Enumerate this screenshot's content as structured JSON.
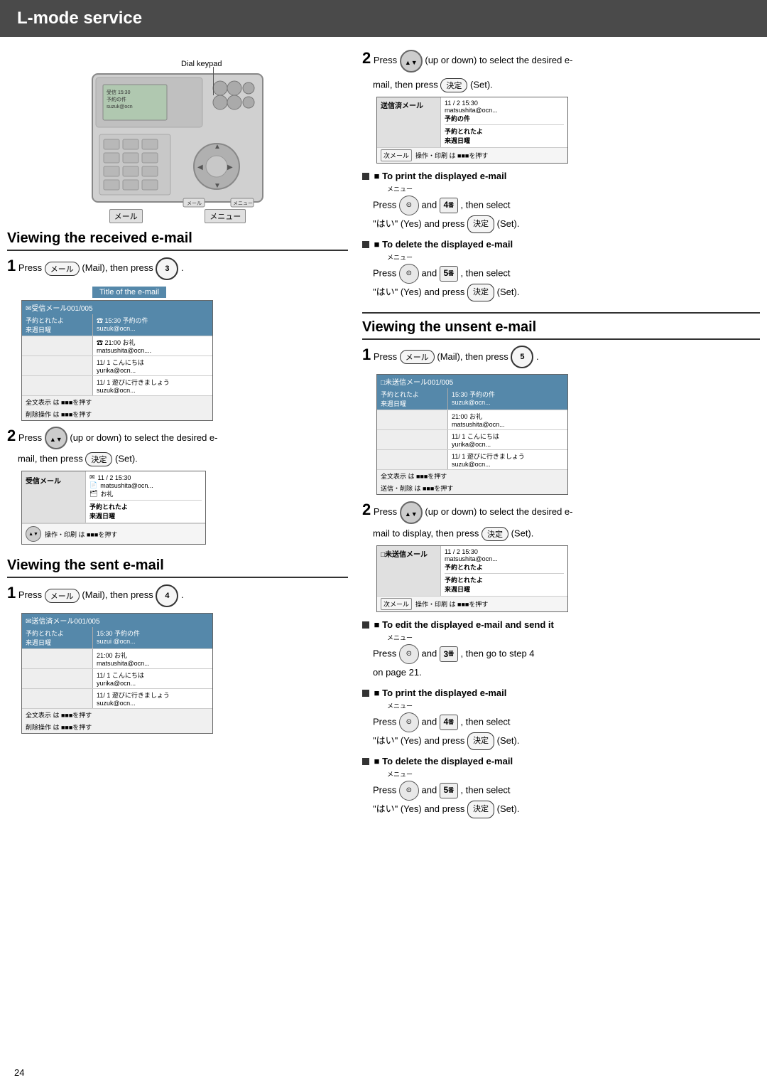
{
  "header": {
    "title": "L-mode service"
  },
  "page_number": "24",
  "device_labels": {
    "dial_keypad": "Dial keypad",
    "mail_button": "メール",
    "menu_button": "メニュー"
  },
  "section_received": {
    "title": "Viewing the received e-mail",
    "step1_text": "Press",
    "step1_mail": "メール",
    "step1_then": "(Mail), then press",
    "step1_num": "3",
    "step2_text": "Press",
    "step2_updown": "(up or down) to select the desired e-",
    "step2_mail_then": "mail, then press",
    "step2_set": "決定",
    "step2_set_label": "(Set).",
    "title_of_email": "Title of the e-mail",
    "screen1": {
      "header": "✉受信メール001/005",
      "row1_right1": "☎ 15:30 予約の件",
      "row1_right2": "suzuk@ocn...",
      "row2_left": "予約とれたよ\n来週日曜",
      "row2_right1": "☎ 21:00 お礼",
      "row2_right2": "matsushita@ocn....",
      "row3_right1": "11/ 1 こんにちは",
      "row3_right2": "yurika@ocn...",
      "footer1": "全文表示 は ■■■を押す",
      "footer2": "削除操作 は ■■■を押す",
      "row4_right1": "11/ 1 遊びに行きましょう",
      "row4_right2": "suzuk@ocn..."
    },
    "screen2": {
      "header_left": "受信メール",
      "icon1": "✉",
      "date": "11 / 2  15:30",
      "icon2": "📄",
      "sender": "matsushita@ocn...",
      "icon3": "🗂",
      "subject": "お礼",
      "divider": "──────────────",
      "body1": "予約とれたよ",
      "body2": "来週日曜",
      "footer": "操作・印刷 は ■■■を押す"
    }
  },
  "section_sent": {
    "title": "Viewing the sent e-mail",
    "step1_text": "Press",
    "step1_mail": "メール",
    "step1_then": "(Mail), then press",
    "step1_num": "4",
    "screen1": {
      "header": "✉送信済メール001/005",
      "row1_right1": "15:30 予約の件",
      "row1_right2": "suzui @ocn...",
      "row2_left": "予約とれたよ\n来週日曜",
      "row2_right1": "21:00 お礼",
      "row2_right2": "matsushita@ocn...",
      "row3_right1": "11/ 1 こんにちは",
      "row3_right2": "yurika@ocn...",
      "footer1": "全文表示 は ■■■を押す",
      "footer2": "削除操作 は ■■■を押す",
      "row4_right1": "11/ 1 遊びに行きましょう",
      "row4_right2": "suzuk@ocn..."
    }
  },
  "section_right_top": {
    "step2_text": "Press",
    "step2_updown": "(up or down) to select the desired e-",
    "step2_mail_then": "mail, then press",
    "step2_set": "決定",
    "step2_set_label": "(Set).",
    "screen": {
      "header_left": "送信済メール",
      "icon_menu": "次メール",
      "date": "11 / 2  15:30",
      "sender": "matsushita@ocn...",
      "subject": "予約の件",
      "body1": "予約とれたよ",
      "body2": "来週日曜",
      "footer": "操作・印刷 は ■■■を押す"
    },
    "print_section": {
      "title": "■ To print the displayed e-mail",
      "menu_label": "メニュー",
      "press": "Press",
      "menu_btn": "Menu",
      "and": "and",
      "num": "4",
      "then_select": ", then select",
      "hai": "\"はい\" (Yes) and press",
      "set": "決定",
      "set_label": "(Set)."
    },
    "delete_section": {
      "title": "■ To delete the displayed e-mail",
      "menu_label": "メニュー",
      "press": "Press",
      "menu_btn": "Menu",
      "and": "and",
      "num": "5",
      "then_select": ", then select",
      "hai": "\"はい\" (Yes) and press",
      "set": "決定",
      "set_label": "(Set)."
    }
  },
  "section_unsent": {
    "title": "Viewing the unsent e-mail",
    "step1_text": "Press",
    "step1_mail": "メール",
    "step1_then": "(Mail), then press",
    "step1_num": "5",
    "screen1": {
      "header": "□未送信メール001/005",
      "row1_right1": "15:30 予約の件",
      "row1_right2": "suzuk@ocn...",
      "row2_left": "予約とれたよ\n来週日曜",
      "row2_right1": "21:00 お礼",
      "row2_right2": "matsushita@ocn...",
      "row3_right1": "11/ 1 こんにちは",
      "row3_right2": "yurika@ocn...",
      "footer1": "全文表示 は ■■■を押す",
      "footer2": "送信・削除 は ■■■を押す",
      "row4_right1": "11/ 1 遊びに行きましょう",
      "row4_right2": "suzuk@ocn..."
    },
    "step2_text": "Press",
    "step2_updown": "(up or down) to select the desired e-",
    "step2_mail_then": "mail to display, then press",
    "step2_set": "決定",
    "step2_set_label": "(Set).",
    "screen2": {
      "header_left": "□未送信メール",
      "icon_menu": "次メール",
      "date": "11 / 2  15:30",
      "sender": "matsushita@ocn...",
      "subject": "予約とれたよ",
      "body1": "予約とれたよ",
      "body2": "来週日曜",
      "footer": "操作・印刷 は ■■■を押す"
    },
    "edit_section": {
      "title": "■ To edit the displayed e-mail and send it",
      "menu_label": "メニュー",
      "press": "Press",
      "menu_btn": "Menu",
      "and": "and",
      "num": "3",
      "then_go": ", then go to step 4",
      "on_page": "on page 21."
    },
    "print_section": {
      "title": "■ To print the displayed e-mail",
      "menu_label": "メニュー",
      "press": "Press",
      "menu_btn": "Menu",
      "and": "and",
      "num": "4",
      "then_select": ", then select",
      "hai": "\"はい\" (Yes) and press",
      "set": "決定",
      "set_label": "(Set)."
    },
    "delete_section": {
      "title": "■ To delete the displayed e-mail",
      "menu_label": "メニュー",
      "press": "Press",
      "menu_btn": "Menu",
      "and": "and",
      "num": "5",
      "then_select": ", then select",
      "hai": "\"はい\" (Yes) and press",
      "set": "決定",
      "set_label": "(Set)."
    }
  },
  "colors": {
    "header_bg": "#4a4a4a",
    "screen_header_blue": "#5588aa",
    "screen_highlight": "#6699bb"
  }
}
